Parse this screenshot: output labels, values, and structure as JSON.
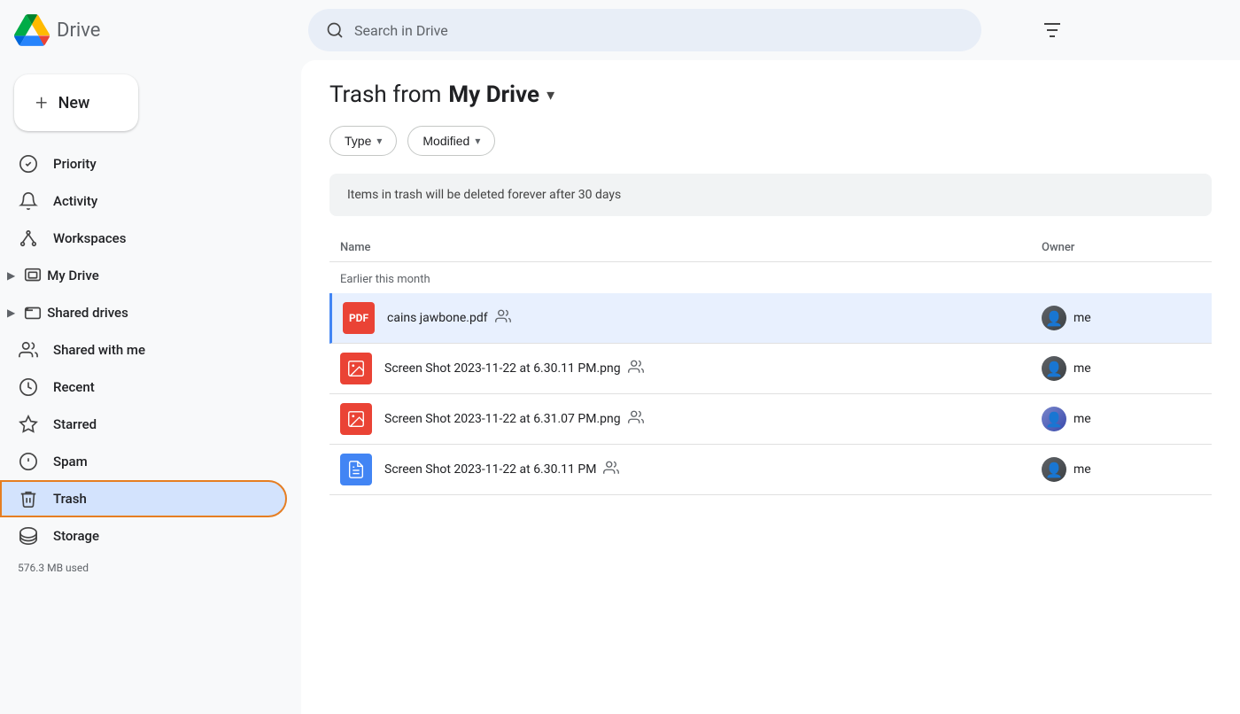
{
  "app": {
    "name": "Drive"
  },
  "search": {
    "placeholder": "Search in Drive"
  },
  "sidebar": {
    "new_button": "New",
    "items": [
      {
        "id": "priority",
        "label": "Priority",
        "icon": "priority"
      },
      {
        "id": "activity",
        "label": "Activity",
        "icon": "activity"
      },
      {
        "id": "workspaces",
        "label": "Workspaces",
        "icon": "workspaces"
      },
      {
        "id": "my-drive",
        "label": "My Drive",
        "icon": "my-drive",
        "expandable": true
      },
      {
        "id": "shared-drives",
        "label": "Shared drives",
        "icon": "shared-drives",
        "expandable": true
      },
      {
        "id": "shared-with-me",
        "label": "Shared with me",
        "icon": "shared-with-me"
      },
      {
        "id": "recent",
        "label": "Recent",
        "icon": "recent"
      },
      {
        "id": "starred",
        "label": "Starred",
        "icon": "starred"
      },
      {
        "id": "spam",
        "label": "Spam",
        "icon": "spam"
      },
      {
        "id": "trash",
        "label": "Trash",
        "icon": "trash",
        "active": true
      },
      {
        "id": "storage",
        "label": "Storage",
        "icon": "storage"
      }
    ],
    "storage_used": "576.3 MB used"
  },
  "content": {
    "title_prefix": "Trash from",
    "title_drive": "My Drive",
    "filters": [
      {
        "label": "Type"
      },
      {
        "label": "Modified"
      }
    ],
    "notice": "Items in trash will be deleted forever after 30 days",
    "table": {
      "col_name": "Name",
      "col_owner": "Owner"
    },
    "section_label": "Earlier this month",
    "files": [
      {
        "id": 1,
        "name": "cains jawbone.pdf",
        "shared": true,
        "type": "pdf",
        "owner": "me",
        "selected": true
      },
      {
        "id": 2,
        "name": "Screen Shot 2023-11-22 at 6.30.11 PM.png",
        "shared": true,
        "type": "png",
        "owner": "me",
        "selected": false
      },
      {
        "id": 3,
        "name": "Screen Shot 2023-11-22 at 6.31.07 PM.png",
        "shared": true,
        "type": "png",
        "owner": "me",
        "selected": false
      },
      {
        "id": 4,
        "name": "Screen Shot 2023-11-22 at 6.30.11 PM",
        "shared": true,
        "type": "doc",
        "owner": "me",
        "selected": false
      }
    ]
  }
}
